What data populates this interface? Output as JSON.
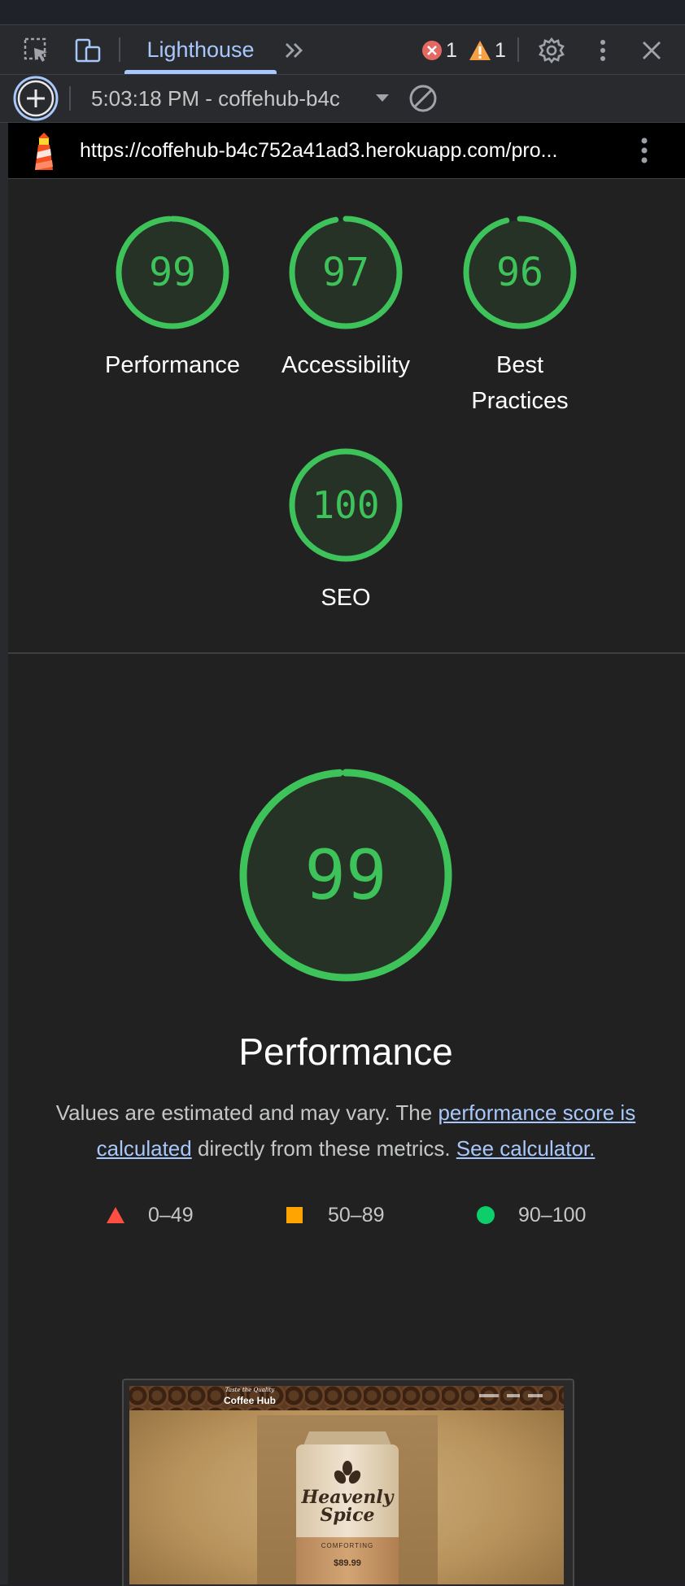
{
  "toolbar": {
    "tab_label": "Lighthouse",
    "error_count": "1",
    "warning_count": "1"
  },
  "runbar": {
    "run_label": "5:03:18 PM - coffehub-b4c"
  },
  "urlbar": {
    "url": "https://coffehub-b4c752a41ad3.herokuapp.com/pro..."
  },
  "scores": [
    {
      "value": "99",
      "label": "Performance"
    },
    {
      "value": "97",
      "label": "Accessibility"
    },
    {
      "value": "96",
      "label_line1": "Best",
      "label_line2": "Practices"
    },
    {
      "value": "100",
      "label": "SEO"
    }
  ],
  "performance": {
    "score": "99",
    "title": "Performance",
    "desc_part1": "Values are estimated and may vary. The ",
    "desc_link1": "performance score is calculated",
    "desc_part2": " directly from these metrics. ",
    "desc_link2": "See calculator."
  },
  "legend": [
    {
      "range": "0–49",
      "color": "#ff4e42"
    },
    {
      "range": "50–89",
      "color": "#ffa400"
    },
    {
      "range": "90–100",
      "color": "#0cce6b"
    }
  ],
  "screenshot": {
    "tagline": "Taste the Quality",
    "site_name": "Coffee Hub",
    "product_name_line1": "Heavenly",
    "product_name_line2": "Spice",
    "product_tag": "COMFORTING",
    "product_price": "$89.99"
  },
  "colors": {
    "score_green": "#3ec35b",
    "gauge_bg": "#263226",
    "accent_blue": "#a8c7fa"
  }
}
